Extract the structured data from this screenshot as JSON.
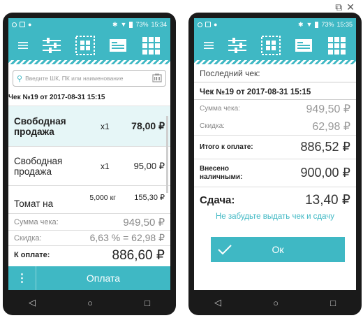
{
  "colors": {
    "accent": "#3fb8c4",
    "screen_bg": "#ffffff",
    "device": "#1a1a1a"
  },
  "window_icons": [
    "external-link-icon",
    "close-icon"
  ],
  "phone1": {
    "status": {
      "battery": "73%",
      "time": "15:34"
    },
    "search": {
      "placeholder": "Введите ШК, ПК или наименование"
    },
    "receipt_header": "Чек №19 от 2017-08-31 15:15",
    "items": [
      {
        "name": "Свободная продажа",
        "qty": "x1",
        "price": "78,00 ₽"
      },
      {
        "name": "Свободная продажа",
        "qty": "x1",
        "price": "95,00 ₽"
      },
      {
        "name": "Томат на",
        "qty": "5,000 кг",
        "price": "155,30 ₽"
      }
    ],
    "sum_label": "Сумма чека:",
    "sum_value": "949,50 ₽",
    "discount_label": "Скидка:",
    "discount_value": "6,63 % = 62,98 ₽",
    "total_label": "К оплате:",
    "total_value": "886,60 ₽",
    "menu_label": "⋮",
    "pay_label": "Оплата"
  },
  "phone2": {
    "status": {
      "battery": "73%",
      "time": "15:35"
    },
    "last_check_label": "Последний чек:",
    "receipt_header": "Чек №19 от 2017-08-31 15:15",
    "sum_label": "Сумма чека:",
    "sum_value": "949,50 ₽",
    "discount_label": "Скидка:",
    "discount_value": "62,98 ₽",
    "topay_label": "Итого к оплате:",
    "topay_value": "886,52 ₽",
    "cash_label_1": "Внесено",
    "cash_label_2": "наличными:",
    "cash_value": "900,00 ₽",
    "change_label": "Сдача:",
    "change_value": "13,40 ₽",
    "reminder": "Не забудьте выдать чек и сдачу",
    "ok_label": "Ок"
  },
  "nav": {
    "back": "◁",
    "home": "○",
    "recent": "□"
  }
}
